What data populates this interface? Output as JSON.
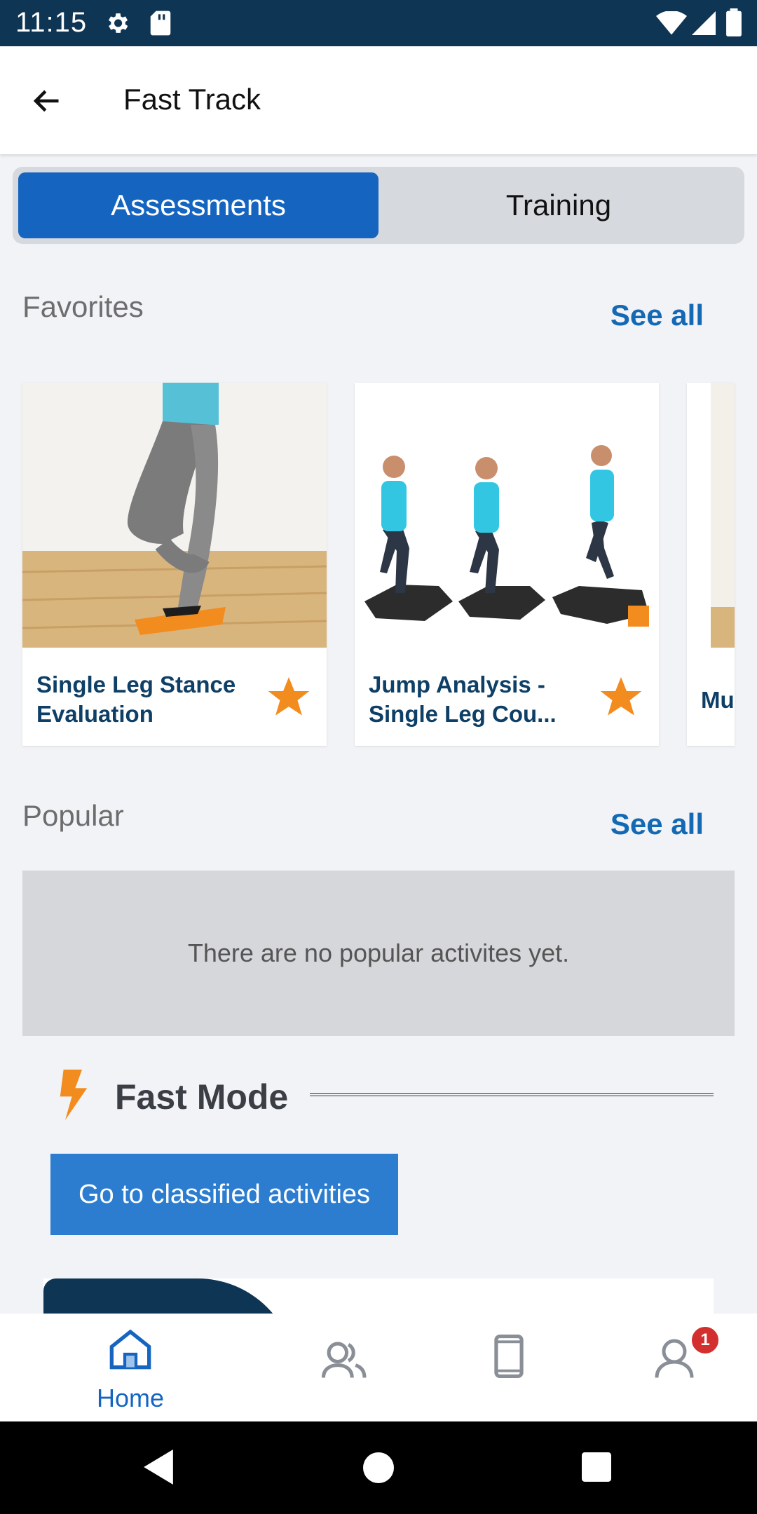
{
  "status_bar": {
    "time": "11:15"
  },
  "app_bar": {
    "title": "Fast Track"
  },
  "segments": {
    "active": "Assessments",
    "inactive": "Training"
  },
  "favorites": {
    "title": "Favorites",
    "see_all": "See all",
    "cards": [
      {
        "name": "Single Leg Stance Evaluation",
        "favorite": true
      },
      {
        "name": "Jump Analysis - Single Leg Cou...",
        "favorite": true
      },
      {
        "name": "Mu",
        "favorite": false
      }
    ]
  },
  "popular": {
    "title": "Popular",
    "see_all": "See all",
    "empty_message": "There are no popular activites yet."
  },
  "fast_mode": {
    "title": "Fast Mode",
    "button_label": "Go to classified activities"
  },
  "bottom_nav": {
    "home_label": "Home",
    "profile_badge": "1"
  },
  "colors": {
    "accent": "#1565c0",
    "status_bar": "#0f3554",
    "star": "#f28c1f"
  }
}
